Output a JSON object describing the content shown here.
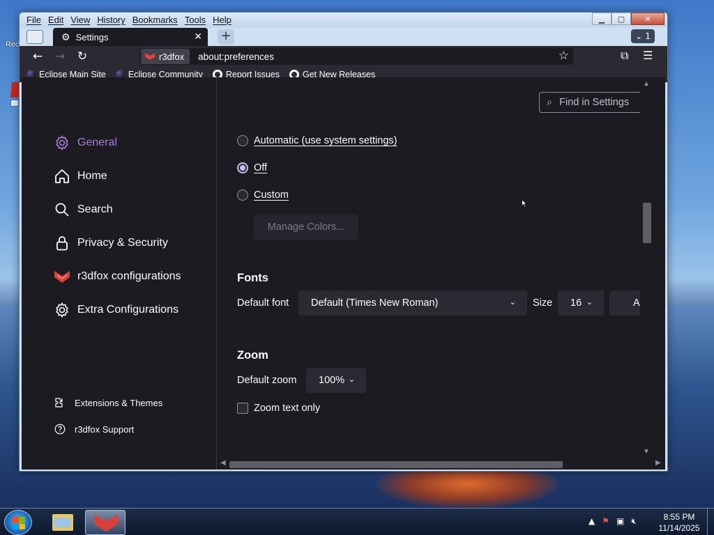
{
  "desktop": {
    "icon_label": "Rec"
  },
  "window": {
    "menu": [
      "File",
      "Edit",
      "View",
      "History",
      "Bookmarks",
      "Tools",
      "Help"
    ],
    "tab_title": "Settings",
    "tab_count": "1",
    "identity_label": "r3dfox",
    "url": "about:preferences",
    "bookmarks": [
      "Eclipse Main Site",
      "Eclipse Community",
      "Report Issues",
      "Get New Releases"
    ]
  },
  "sidebar": {
    "categories": [
      {
        "label": "General",
        "icon": "gear-icon",
        "selected": true
      },
      {
        "label": "Home",
        "icon": "home-icon"
      },
      {
        "label": "Search",
        "icon": "search-icon"
      },
      {
        "label": "Privacy & Security",
        "icon": "lock-icon"
      },
      {
        "label": "r3dfox configurations",
        "icon": "fox-icon"
      },
      {
        "label": "Extra Configurations",
        "icon": "gear-icon"
      }
    ],
    "footer": [
      {
        "label": "Extensions & Themes",
        "icon": "puzzle-icon"
      },
      {
        "label": "r3dfox Support",
        "icon": "help-icon"
      }
    ]
  },
  "main": {
    "search_placeholder": "Find in Settings",
    "contrast_options": [
      {
        "label": "Automatic (use system settings)",
        "checked": false
      },
      {
        "label": "Off",
        "checked": true
      },
      {
        "label": "Custom",
        "checked": false
      }
    ],
    "manage_colors_label": "Manage Colors...",
    "fonts": {
      "heading": "Fonts",
      "default_font_label": "Default font",
      "default_font_value": "Default (Times New Roman)",
      "size_label": "Size",
      "size_value": "16",
      "advanced_label": "Adv"
    },
    "zoom": {
      "heading": "Zoom",
      "default_zoom_label": "Default zoom",
      "default_zoom_value": "100%",
      "zoom_text_only_label": "Zoom text only"
    }
  },
  "taskbar": {
    "time": "8:55 PM",
    "date": "11/14/2025"
  },
  "colors": {
    "accent": "#a87dd8",
    "content_bg": "#1c1b22",
    "toolbar_bg": "#2b2a33"
  }
}
